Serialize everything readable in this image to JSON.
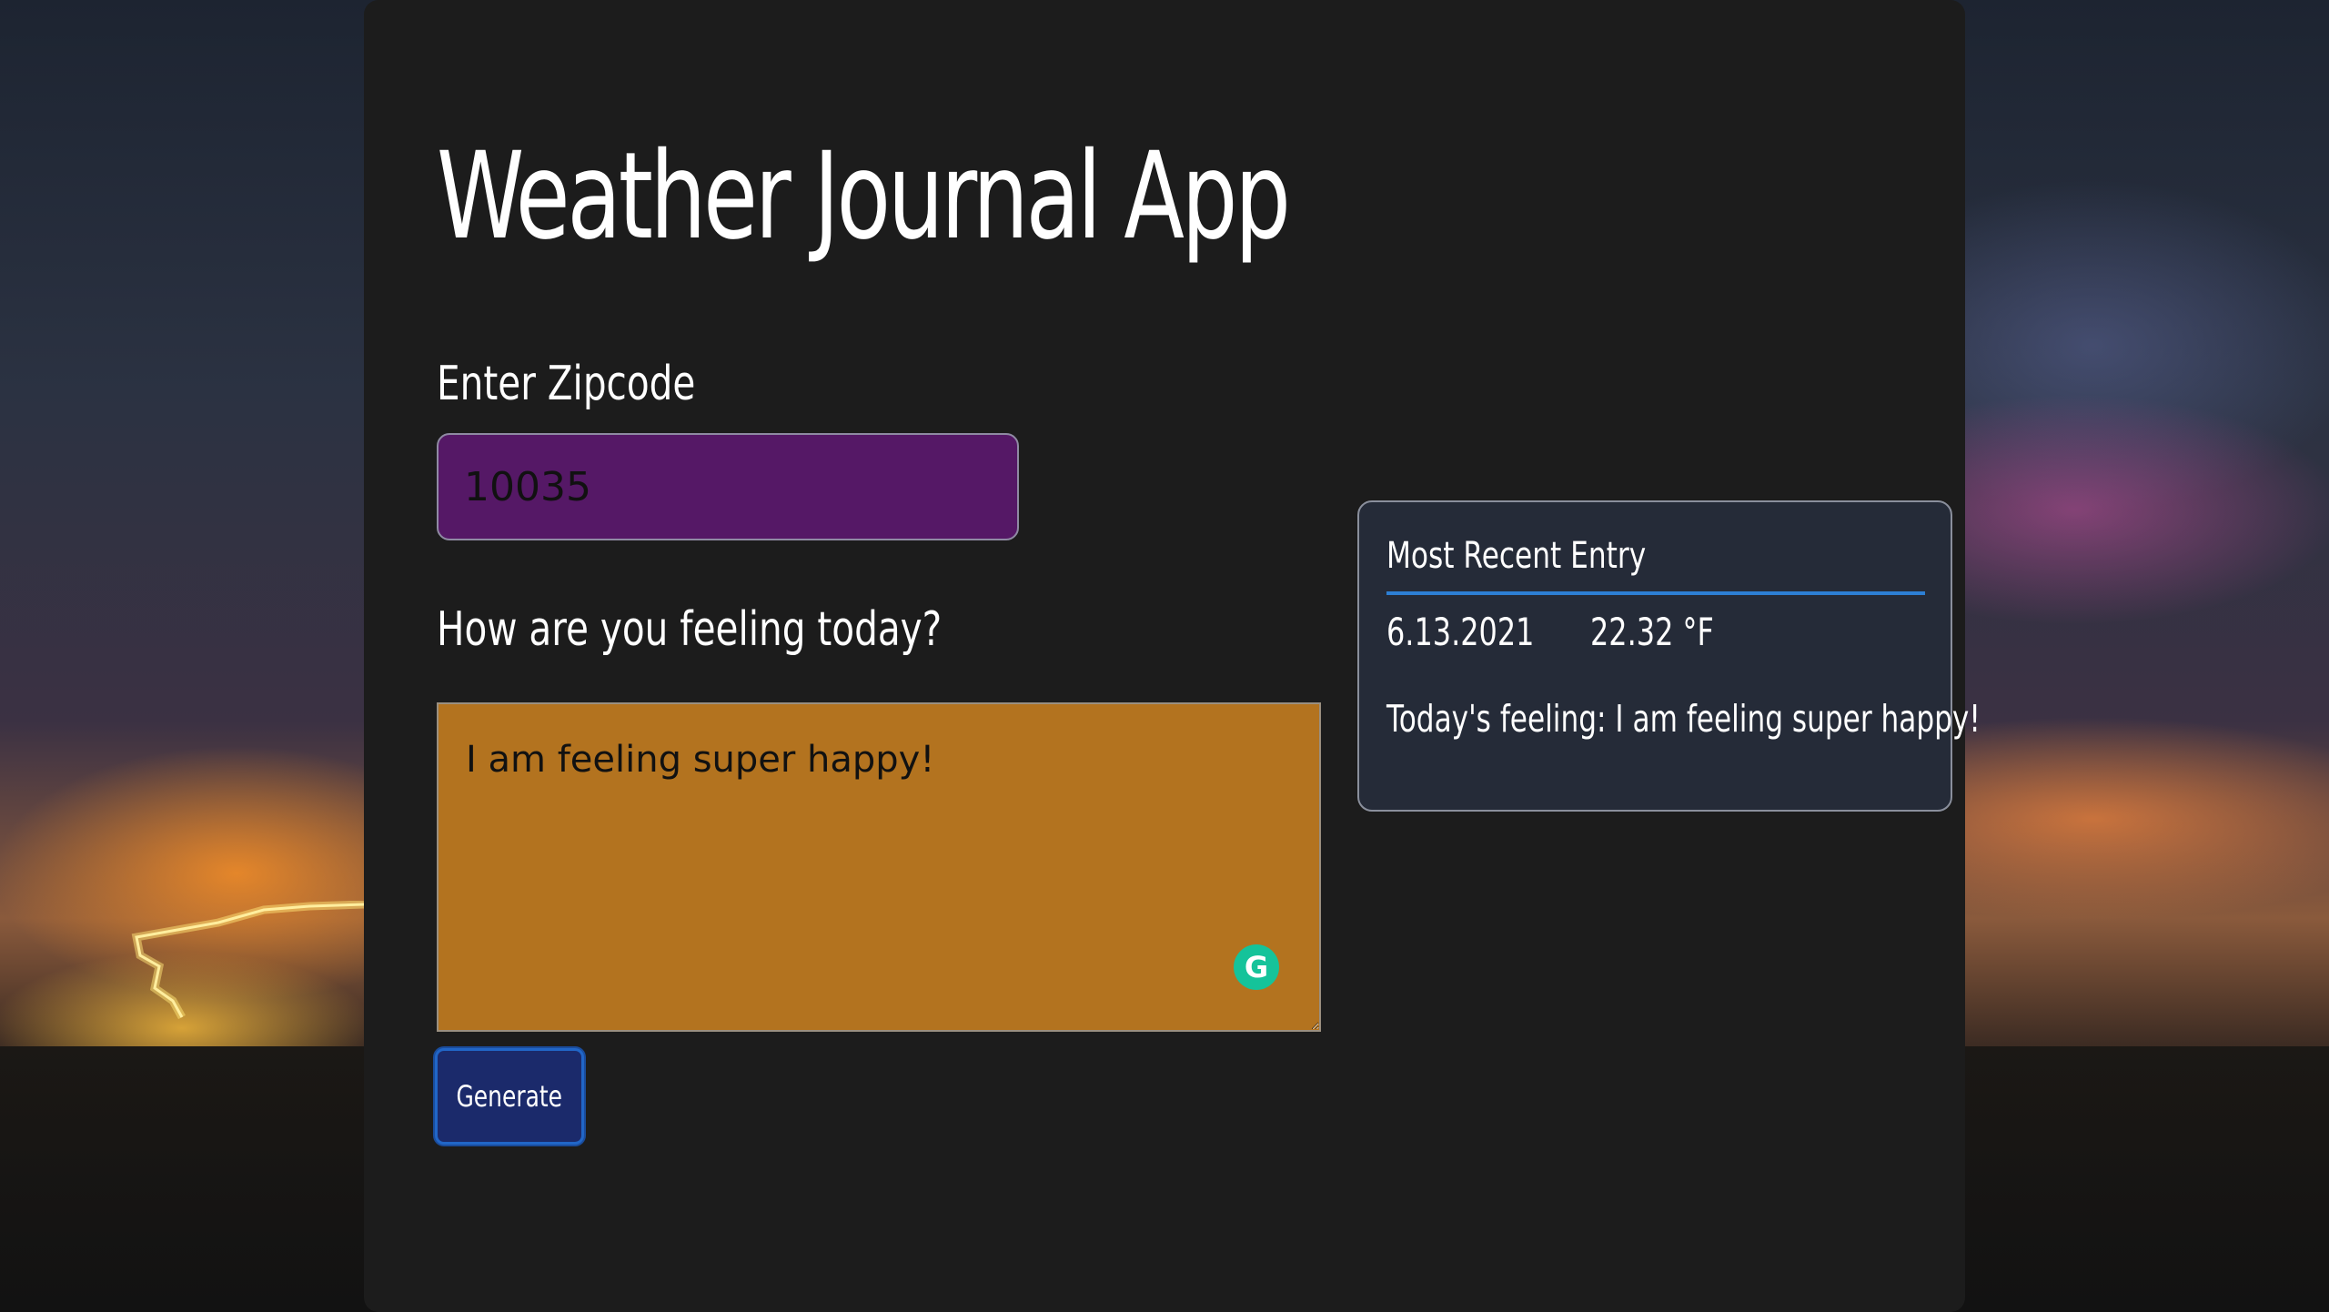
{
  "app": {
    "title": "Weather Journal App"
  },
  "zip": {
    "label": "Enter Zipcode",
    "value": "10035"
  },
  "feelings": {
    "label": "How are you feeling today?",
    "value": "I am feeling super happy!",
    "extension_icon": "grammarly-icon"
  },
  "generate_button": {
    "label": "Generate"
  },
  "recent_entry": {
    "title": "Most Recent Entry",
    "date": "6.13.2021",
    "temp": "22.32 °F",
    "content": "Today's feeling: I am feeling super happy!"
  },
  "colors": {
    "panel_bg": "#1c1c1c",
    "zip_input_bg": "#551866",
    "feelings_input_bg": "#b3731f",
    "button_bg": "#1b2a6b",
    "button_border": "#2166c7",
    "card_bg": "#252b38",
    "card_underline": "#2d7fd4"
  }
}
